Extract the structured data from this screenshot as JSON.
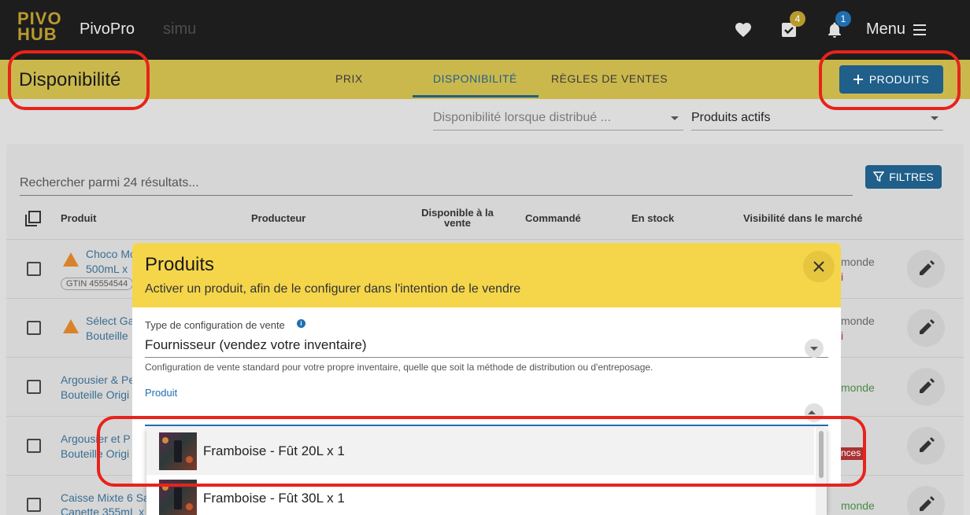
{
  "topbar": {
    "logo_line1": "PIVO",
    "logo_line2": "HUB",
    "app_name": "PivoPro",
    "org_name": "simu",
    "tasks_badge": "4",
    "notifications_badge": "1",
    "menu_label": "Menu"
  },
  "header": {
    "page_title": "Disponibilité",
    "tabs": [
      {
        "label": "PRIX"
      },
      {
        "label": "DISPONIBILITÉ"
      },
      {
        "label": "RÈGLES DE VENTES"
      }
    ],
    "add_products_label": "PRODUITS"
  },
  "filters": {
    "distribution_select": "Disponibilité lorsque distribué ...",
    "status_select": "Produits actifs"
  },
  "table": {
    "search_placeholder": "Rechercher parmi 24 résultats...",
    "filter_button": "FILTRES",
    "columns": {
      "product": "Produit",
      "producer": "Producteur",
      "available_line1": "Disponible à la",
      "available_line2": "vente",
      "ordered": "Commandé",
      "in_stock": "En stock",
      "visibility": "Visibilité dans le marché"
    },
    "rows": [
      {
        "line1": "Choco Mo",
        "line2": "500mL x",
        "gtin": "GTIN 45554544",
        "visibility": "monde",
        "visibility_extra": "i"
      },
      {
        "line1": "Sélect Ga",
        "line2": "Bouteille",
        "visibility": "monde",
        "visibility_extra": "i"
      },
      {
        "line1": "Argousier & Pe",
        "line2": "Bouteille Origi",
        "visibility": "monde"
      },
      {
        "line1": "Argousier et P",
        "line2": "Bouteille Origi",
        "visibility": "nces"
      },
      {
        "line1": "Caisse Mixte 6 Sa",
        "line2": "Canette 355mL x",
        "visibility": "monde"
      }
    ]
  },
  "modal": {
    "title": "Produits",
    "subtitle": "Activer un produit, afin de le configurer dans l'intention de le vendre",
    "config_label": "Type de configuration de vente",
    "config_value": "Fournisseur (vendez votre inventaire)",
    "config_help": "Configuration de vente standard pour votre propre inventaire, quelle que soit la méthode de distribution ou d'entreposage.",
    "product_label": "Produit",
    "options": [
      {
        "label": "Framboise - Fût 20L x 1"
      },
      {
        "label": "Framboise - Fût 30L x 1"
      }
    ]
  },
  "colors": {
    "topbar_bg": "#1d1d1d",
    "header_yellow": "#cbb84d",
    "modal_yellow": "#f5d64b",
    "primary_blue": "#1f5f8a",
    "annotation_red": "#e8231b"
  }
}
